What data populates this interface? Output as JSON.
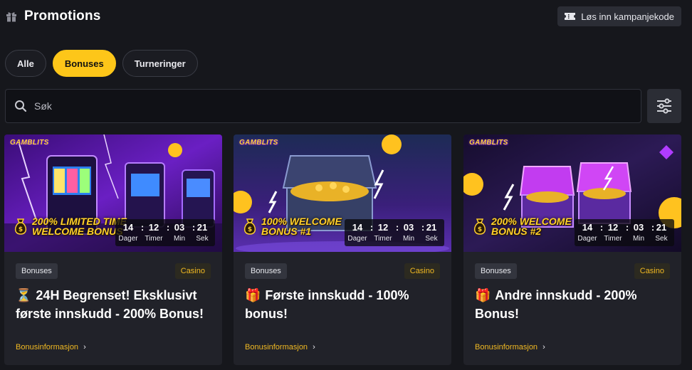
{
  "header": {
    "title": "Promotions",
    "redeem_label": "Løs inn kampanjekode"
  },
  "tabs": [
    {
      "label": "Alle",
      "active": false
    },
    {
      "label": "Bonuses",
      "active": true
    },
    {
      "label": "Turneringer",
      "active": false
    }
  ],
  "search": {
    "placeholder": "Søk"
  },
  "colors": {
    "accent": "#fdc619",
    "background": "#16171c",
    "card": "#212229"
  },
  "cards": [
    {
      "brand": "GAMBLITS",
      "banner_text": "200% LIMITED TIME WELCOME BONUS",
      "countdown": {
        "days": "14",
        "hours": "12",
        "minutes": "03",
        "seconds": "21"
      },
      "countdown_labels": {
        "days": "Dager",
        "hours": "Timer",
        "minutes": "Min",
        "seconds": "Sek"
      },
      "type_tag": "Bonuses",
      "category_tag": "Casino",
      "emoji": "⏳",
      "headline": "24H Begrenset! Eksklusivt første innskudd - 200% Bonus!",
      "link": "Bonusinformasjon"
    },
    {
      "brand": "GAMBLITS",
      "banner_text": "100% WELCOME BONUS #1",
      "countdown": {
        "days": "14",
        "hours": "12",
        "minutes": "03",
        "seconds": "21"
      },
      "countdown_labels": {
        "days": "Dager",
        "hours": "Timer",
        "minutes": "Min",
        "seconds": "Sek"
      },
      "type_tag": "Bonuses",
      "category_tag": "Casino",
      "emoji": "🎁",
      "headline": "Første innskudd - 100% bonus!",
      "link": "Bonusinformasjon"
    },
    {
      "brand": "GAMBLITS",
      "banner_text": "200% WELCOME BONUS #2",
      "countdown": {
        "days": "14",
        "hours": "12",
        "minutes": "03",
        "seconds": "21"
      },
      "countdown_labels": {
        "days": "Dager",
        "hours": "Timer",
        "minutes": "Min",
        "seconds": "Sek"
      },
      "type_tag": "Bonuses",
      "category_tag": "Casino",
      "emoji": "🎁",
      "headline": "Andre innskudd - 200% Bonus!",
      "link": "Bonusinformasjon"
    }
  ]
}
